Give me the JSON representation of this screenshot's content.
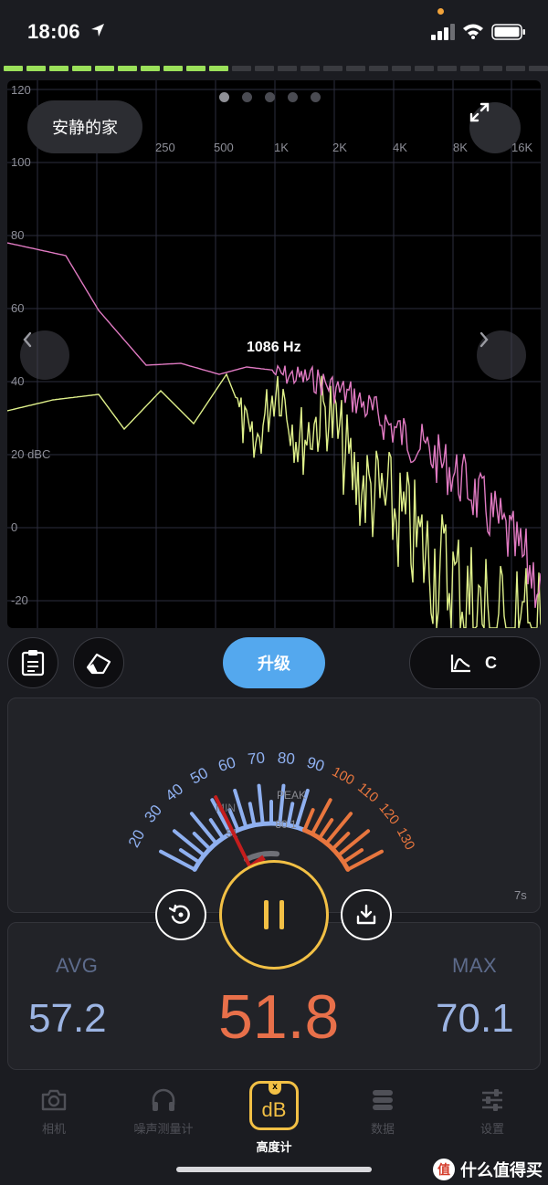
{
  "status_bar": {
    "time": "18:06"
  },
  "level_meter": {
    "lit_segments": 10,
    "total_segments": 24,
    "on_color": "#9be05a",
    "off_color": "#3a3b40"
  },
  "spectrum": {
    "location_label": "安静的家",
    "page_count": 5,
    "active_page": 0,
    "freq_readout": "1086 Hz",
    "y_ticks": [
      "120",
      "100",
      "80",
      "60",
      "40",
      "20 dBC",
      "0",
      "-20"
    ],
    "x_ticks": [
      "250",
      "500",
      "1K",
      "2K",
      "4K",
      "8K",
      "16K"
    ],
    "curves": {
      "peak_color": "#e07ac2",
      "current_color": "#dff08a"
    }
  },
  "toolbar": {
    "upgrade_label": "升级",
    "weighting_label": "C"
  },
  "gauge": {
    "scale_left": [
      "20",
      "30",
      "40",
      "50",
      "60",
      "70",
      "80",
      "90"
    ],
    "scale_right": [
      "100",
      "110",
      "120",
      "130"
    ],
    "min_label": "MIN",
    "min_value": "51",
    "peak_label": "PEAK",
    "peak_value": "80.1",
    "needle_value": 51.8,
    "duration": "7s",
    "blue_color": "#8fb0f0",
    "orange_color": "#e8763e"
  },
  "stats": {
    "avg_label": "AVG",
    "avg_value": "57.2",
    "current_value": "51.8",
    "max_label": "MAX",
    "max_value": "70.1"
  },
  "tabs": [
    {
      "label": "相机",
      "icon": "camera-icon"
    },
    {
      "label": "噪声测量计",
      "icon": "headphones-icon"
    },
    {
      "label": "高度计",
      "icon": "db-badge-icon"
    },
    {
      "label": "数据",
      "icon": "database-icon"
    },
    {
      "label": "设置",
      "icon": "sliders-icon"
    }
  ],
  "watermark": {
    "glyph": "值",
    "text": "什么值得买"
  }
}
